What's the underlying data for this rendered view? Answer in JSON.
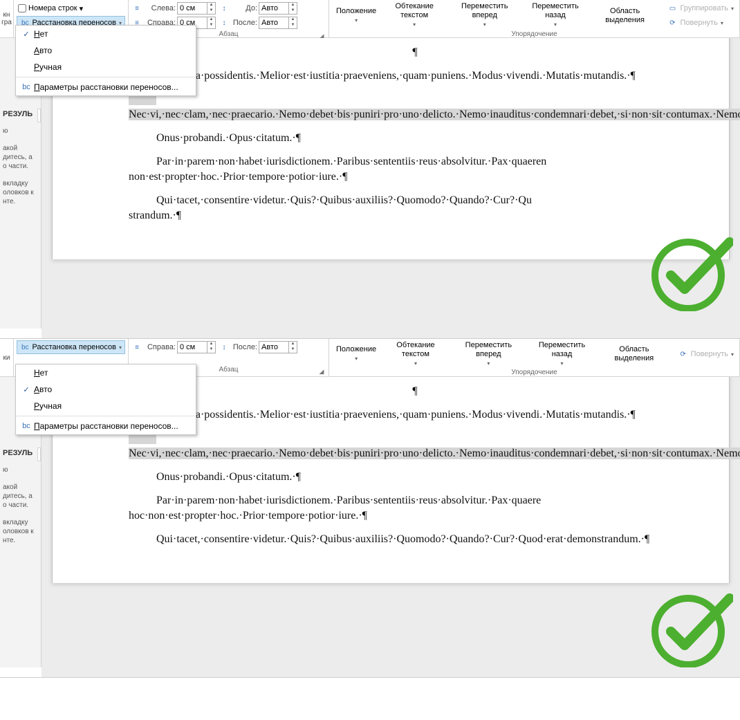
{
  "ribbon": {
    "lineNumbers": "Номера строк",
    "hyphenation": "Расстановка переносов",
    "left": "Слева:",
    "right": "Справа:",
    "before": "До:",
    "after": "После:",
    "zeroCm": "0 см",
    "auto": "Авто",
    "paragraphGroup": "Абзац",
    "position": "Положение",
    "textWrap": "Обтекание текстом",
    "bringForward": "Переместить вперед",
    "sendBackward": "Переместить назад",
    "selectionPane": "Область выделения",
    "arrangeGroup": "Упорядочение",
    "group": "Группировать",
    "rotate": "Повернуть"
  },
  "dropdown": {
    "none": "Нет",
    "auto": "Авто",
    "manual": "Ручная",
    "options": "Параметры расстановки переносов..."
  },
  "leftPanel": {
    "results": "РЕЗУЛЬ",
    "text1": "ю",
    "text2a": "акой",
    "text2b": "дитесь, а",
    "text2c": "о части.",
    "text3a": "вкладку",
    "text3b": "оловков к",
    "text3c": "нте."
  },
  "doc": {
    "p1_top": "¶",
    "p2": "·est·causa·possidentis.·Melior·est·iustitia·praeveniens,·quam·puniens.·Modus·vivendi.·Mutatis·mutandis.·¶",
    "p3": "Nec·vi,·nec·clam,·nec·praecario.·Nemo·debet·bis·puniri·pro·uno·delicto.·Nemo·inauditus·condemnari·debet,·si·non·sit·contumax.·Nemo·iudex·in·propria·causa.·Nemo·pluris·iuris·ad·alium·transfere·potest,·quam·ipse·haberet.·Nemo·praesens·nisi·intelligat.·Nemo·praesumitur·malus.·Non·bis·in·idem.·Non·efficit·affectus·nisi·sequatur·effectus.·Non·obligat·lex,·nisi·promulgata.·Non·omne,·quod·licet,·honestum·est.·Non·progredi·est·regredi.·Non·videtur·vim·facere,·qui·iure·suo·utitur.·Nullum·crimen,·nulla·poena·sine·lege.·¶",
    "p4": "Onus·probandi.·Opus·citatum.·¶",
    "p5a": "Par·in·parem·non·habet·iurisdictionem.·Paribus·sententiis·reus·absolvitur.·Pax·quaeren",
    "p5a2": "non·est·propter·hoc.·Prior·tempore·potior·iure.·¶",
    "p5b": "Par·in·parem·non·habet·iurisdictionem.·Paribus·sententiis·reus·absolvitur.·Pax·quaere",
    "p5b2": "hoc·non·est·propter·hoc.·Prior·tempore·potior·iure.·¶",
    "p6a": "Qui·tacet,·consentire·videtur.·Quis?·Quibus·auxiliis?·Quomodo?·Quando?·Cur?·Qu",
    "p6a2": "strandum.·¶",
    "p6b": "Qui·tacet,·consentire·videtur.·Quis?·Quibus·auxiliis?·Quomodo?·Quando?·Cur?·Quod·erat·demonstrandum.·¶"
  }
}
